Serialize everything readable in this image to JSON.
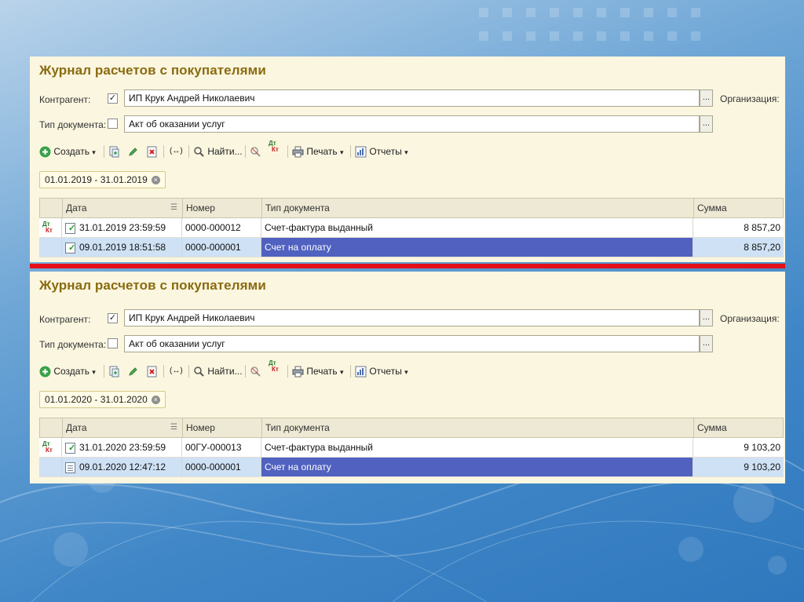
{
  "panels": [
    {
      "title": "Журнал расчетов с покупателями",
      "kontragent_label": "Контрагент:",
      "kontragent_checked": true,
      "kontragent_value": "ИП Крук Андрей Николаевич",
      "org_label": "Организация:",
      "doctype_label": "Тип документа:",
      "doctype_checked": false,
      "doctype_value": "Акт об оказании услуг",
      "toolbar": {
        "create": "Создать",
        "find": "Найти...",
        "print": "Печать",
        "reports": "Отчеты"
      },
      "period": "01.01.2019 - 31.01.2019",
      "columns": [
        "Дата",
        "Номер",
        "Тип документа",
        "Сумма"
      ],
      "rows": [
        {
          "date": "31.01.2019 23:59:59",
          "number": "0000-000012",
          "type": "Счет-фактура выданный",
          "sum": "8 857,20"
        },
        {
          "date": "09.01.2019 18:51:58",
          "number": "0000-000001",
          "type": "Счет на оплату",
          "sum": "8 857,20"
        }
      ]
    },
    {
      "title": "Журнал расчетов с покупателями",
      "kontragent_label": "Контрагент:",
      "kontragent_checked": true,
      "kontragent_value": "ИП Крук Андрей Николаевич",
      "org_label": "Организация:",
      "doctype_label": "Тип документа:",
      "doctype_checked": false,
      "doctype_value": "Акт об оказании услуг",
      "toolbar": {
        "create": "Создать",
        "find": "Найти...",
        "print": "Печать",
        "reports": "Отчеты"
      },
      "period": "01.01.2020 - 31.01.2020",
      "columns": [
        "Дата",
        "Номер",
        "Тип документа",
        "Сумма"
      ],
      "rows": [
        {
          "date": "31.01.2020 23:59:59",
          "number": "00ГУ-000013",
          "type": "Счет-фактура выданный",
          "sum": "9 103,20"
        },
        {
          "date": "09.01.2020 12:47:12",
          "number": "0000-000001",
          "type": "Счет на оплату",
          "sum": "9 103,20"
        }
      ]
    }
  ],
  "icons": {
    "dt": "Дт",
    "kt": "Кт",
    "ellipsis": "...",
    "clear": "×",
    "check": "✓",
    "arrows": "(↔)"
  },
  "colors": {
    "panel_bg": "#fbf6e0",
    "title": "#8a6b10",
    "divider": "#e3101a",
    "selected_cell": "#5061c0",
    "selected_row": "#cfe1f4"
  }
}
